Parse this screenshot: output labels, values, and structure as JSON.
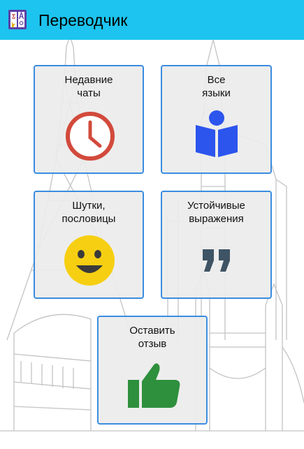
{
  "app": {
    "title": "Переводчик",
    "logo_icon": "translator-app-icon",
    "colors": {
      "app_bar": "#1cc4ef",
      "tile_border": "#3a8de0",
      "tile_bg": "#ececec"
    }
  },
  "tiles": [
    {
      "label": "Недавние\nчаты",
      "icon": "clock-icon",
      "color": "#d24a3c"
    },
    {
      "label": "Все\nязыки",
      "icon": "reader-book-icon",
      "color": "#2c55ee"
    },
    {
      "label": "Шутки,\nпословицы",
      "icon": "smiley-face-icon",
      "color": "#f6cf12"
    },
    {
      "label": "Устойчивые\nвыражения",
      "icon": "quotation-marks-icon",
      "color": "#3e5464"
    },
    {
      "label": "Оставить\nотзыв",
      "icon": "thumbs-up-icon",
      "color": "#2e8f3c"
    }
  ]
}
